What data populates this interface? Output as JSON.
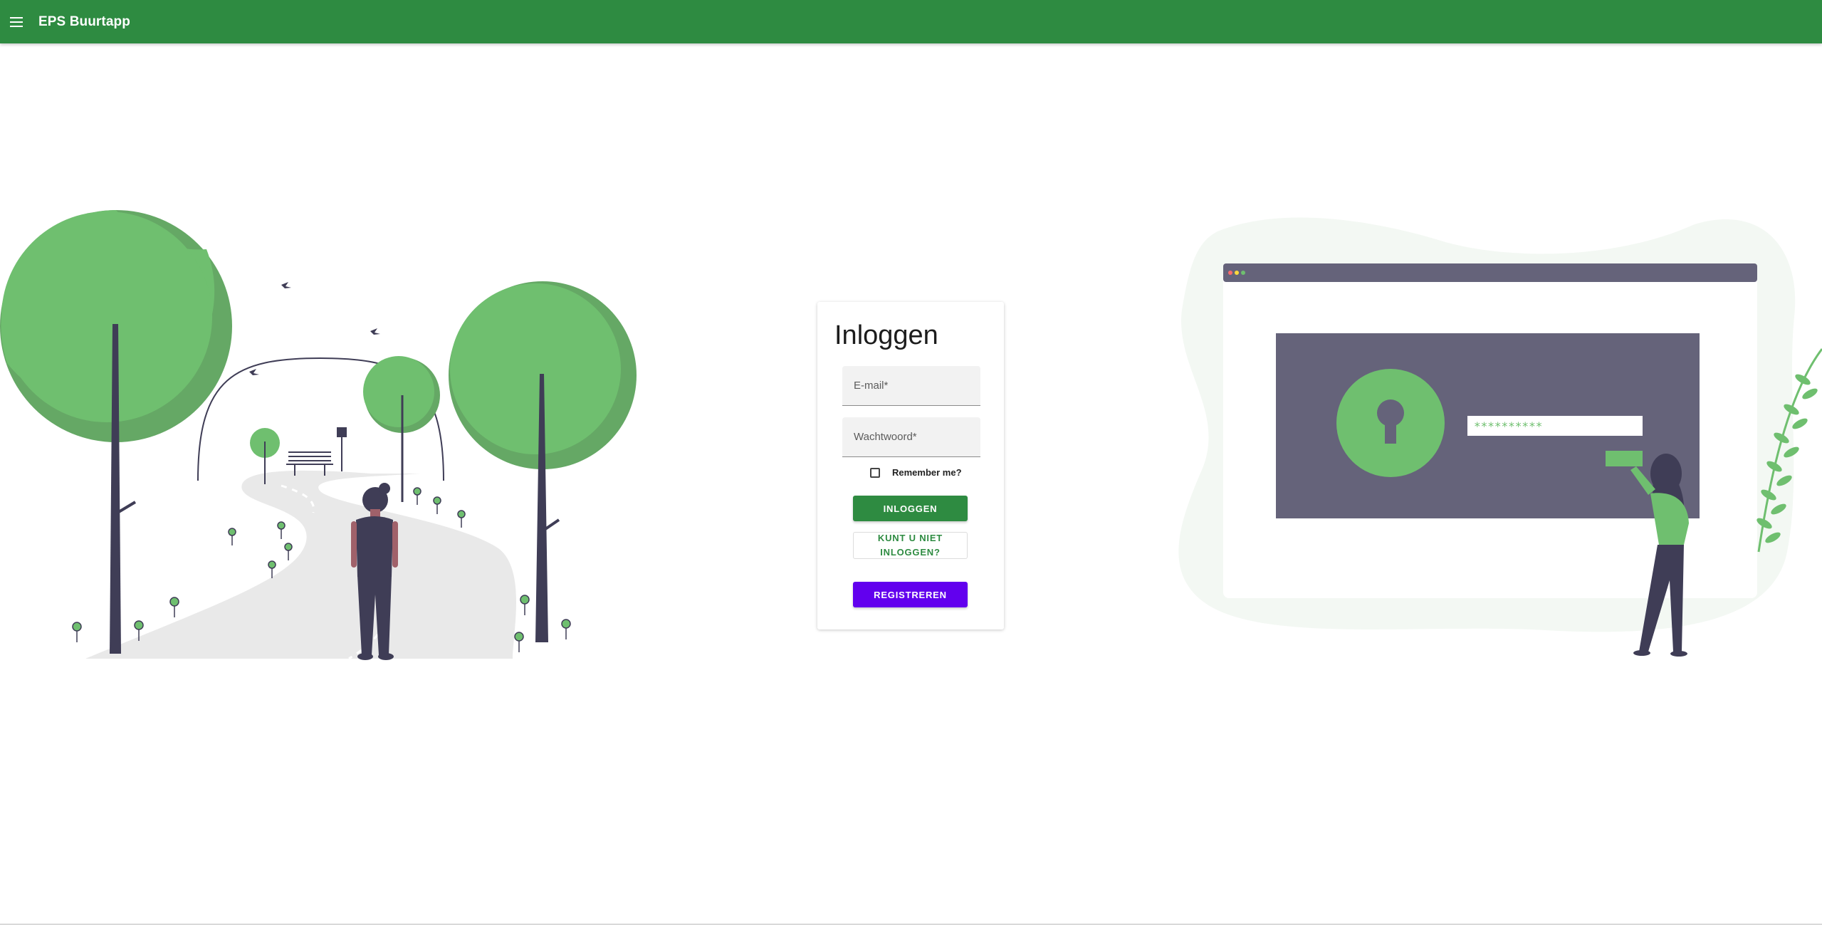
{
  "app": {
    "title": "EPS Buurtapp",
    "primary_color": "#2e8b41",
    "register_color": "#6200ee"
  },
  "appbar": {
    "menu_icon": "hamburger-menu-icon"
  },
  "login": {
    "title": "Inloggen",
    "email_placeholder": "E-mail*",
    "email_value": "",
    "password_placeholder": "Wachtwoord*",
    "password_value": "",
    "remember_label": "Remember me?",
    "remember_checked": false,
    "login_button": "INLOGGEN",
    "forgot_button": "KUNT U NIET INLOGGEN?",
    "register_button": "REGISTREREN"
  },
  "illustration_right": {
    "password_mask": "**********"
  }
}
